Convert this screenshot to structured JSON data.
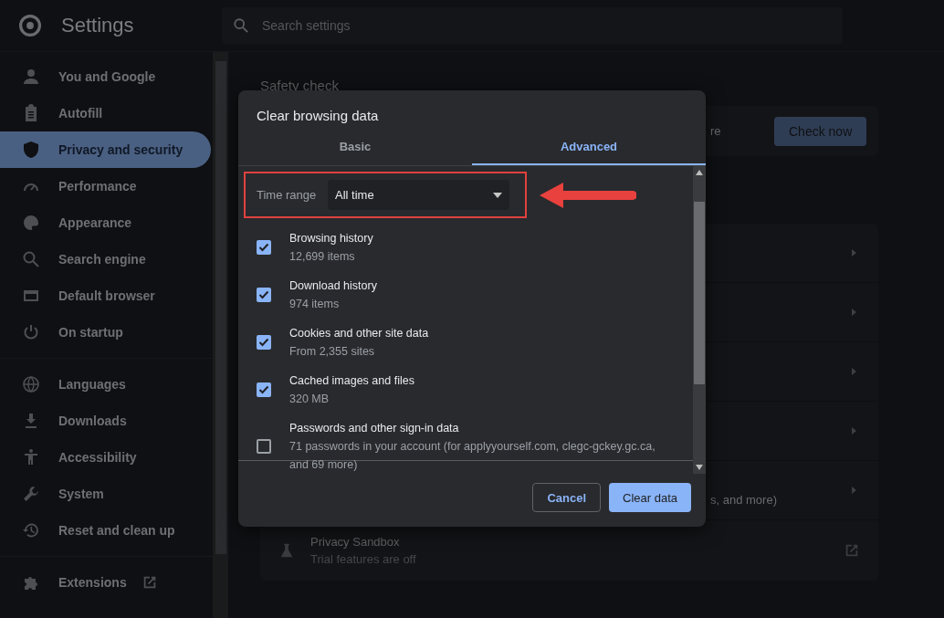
{
  "header": {
    "title": "Settings",
    "search": {
      "placeholder": "Search settings"
    }
  },
  "sidebar": {
    "groups": [
      {
        "items": [
          {
            "label": "You and Google",
            "selected": false
          },
          {
            "label": "Autofill",
            "selected": false
          },
          {
            "label": "Privacy and security",
            "selected": true
          },
          {
            "label": "Performance",
            "selected": false
          },
          {
            "label": "Appearance",
            "selected": false
          },
          {
            "label": "Search engine",
            "selected": false
          },
          {
            "label": "Default browser",
            "selected": false
          },
          {
            "label": "On startup",
            "selected": false
          }
        ]
      },
      {
        "items": [
          {
            "label": "Languages",
            "selected": false
          },
          {
            "label": "Downloads",
            "selected": false
          },
          {
            "label": "Accessibility",
            "selected": false
          },
          {
            "label": "System",
            "selected": false
          },
          {
            "label": "Reset and clean up",
            "selected": false
          }
        ]
      },
      {
        "items": [
          {
            "label": "Extensions",
            "selected": false,
            "external": true
          }
        ]
      }
    ]
  },
  "main": {
    "section_title": "Safety check",
    "safety_card": {
      "text_fragment": "re",
      "button": "Check now"
    },
    "rows": [
      {},
      {},
      {},
      {},
      {
        "text_fragment": "s, and more)"
      }
    ],
    "privacy_sandbox": {
      "title": "Privacy Sandbox",
      "subtitle": "Trial features are off"
    }
  },
  "dialog": {
    "title": "Clear browsing data",
    "tabs": [
      {
        "label": "Basic",
        "selected": false
      },
      {
        "label": "Advanced",
        "selected": true
      }
    ],
    "time_range": {
      "label": "Time range",
      "value": "All time"
    },
    "items": [
      {
        "label": "Browsing history",
        "detail": "12,699 items",
        "checked": true
      },
      {
        "label": "Download history",
        "detail": "974 items",
        "checked": true
      },
      {
        "label": "Cookies and other site data",
        "detail": "From 2,355 sites",
        "checked": true
      },
      {
        "label": "Cached images and files",
        "detail": "320 MB",
        "checked": true
      },
      {
        "label": "Passwords and other sign-in data",
        "detail": "71 passwords in your account (for applyyourself.com, clegc-gckey.gc.ca, and 69 more)",
        "checked": false
      }
    ],
    "buttons": [
      {
        "label": "Cancel",
        "kind": "secondary"
      },
      {
        "label": "Clear data",
        "kind": "primary"
      }
    ]
  }
}
